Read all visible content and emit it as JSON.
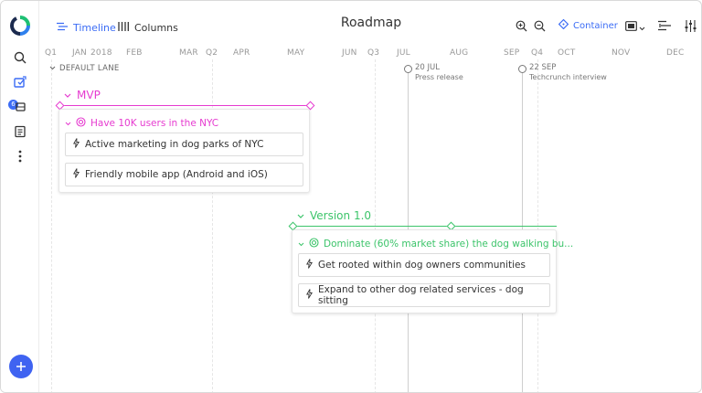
{
  "app": {
    "title": "Roadmap"
  },
  "rail": {
    "logo": "roadmap-logo",
    "items": [
      {
        "name": "search-icon"
      },
      {
        "name": "releases-icon"
      },
      {
        "name": "integrations-icon",
        "badge": "6"
      },
      {
        "name": "notes-icon"
      },
      {
        "name": "more-icon"
      }
    ],
    "fab_icon": "plus-icon"
  },
  "toolbar": {
    "timeline_label": "Timeline",
    "columns_label": "Columns",
    "container_label": "Container",
    "icons": [
      "zoom-in-icon",
      "zoom-out-icon",
      "container-icon",
      "view-size-icon",
      "chevron-down-icon",
      "list-settings-icon",
      "filter-sliders-icon"
    ]
  },
  "timeline": {
    "months": [
      "Q1",
      "JAN",
      "2018",
      "FEB",
      "MAR",
      "Q2",
      "APR",
      "MAY",
      "JUN",
      "Q3",
      "JUL",
      "AUG",
      "SEP",
      "Q4",
      "OCT",
      "NOV",
      "DEC"
    ],
    "lane_label": "DEFAULT LANE",
    "milestones": [
      {
        "date": "20 JUL",
        "label": "Press release"
      },
      {
        "date": "22 SEP",
        "label": "Techcrunch interview"
      }
    ]
  },
  "releases": [
    {
      "name": "MVP",
      "color": "#e63bd0",
      "goal": "Have 10K users in the NYC",
      "items": [
        "Active marketing in dog parks of NYC",
        "Friendly mobile app (Android and iOS)"
      ]
    },
    {
      "name": "Version 1.0",
      "color": "#3cc46a",
      "goal": "Dominate (60% market share) the dog walking bu...",
      "items": [
        "Get rooted within dog owners communities",
        "Expand to other dog related services - dog sitting"
      ]
    }
  ],
  "colors": {
    "accent": "#3b6cf5",
    "fab": "#3f63f1"
  }
}
